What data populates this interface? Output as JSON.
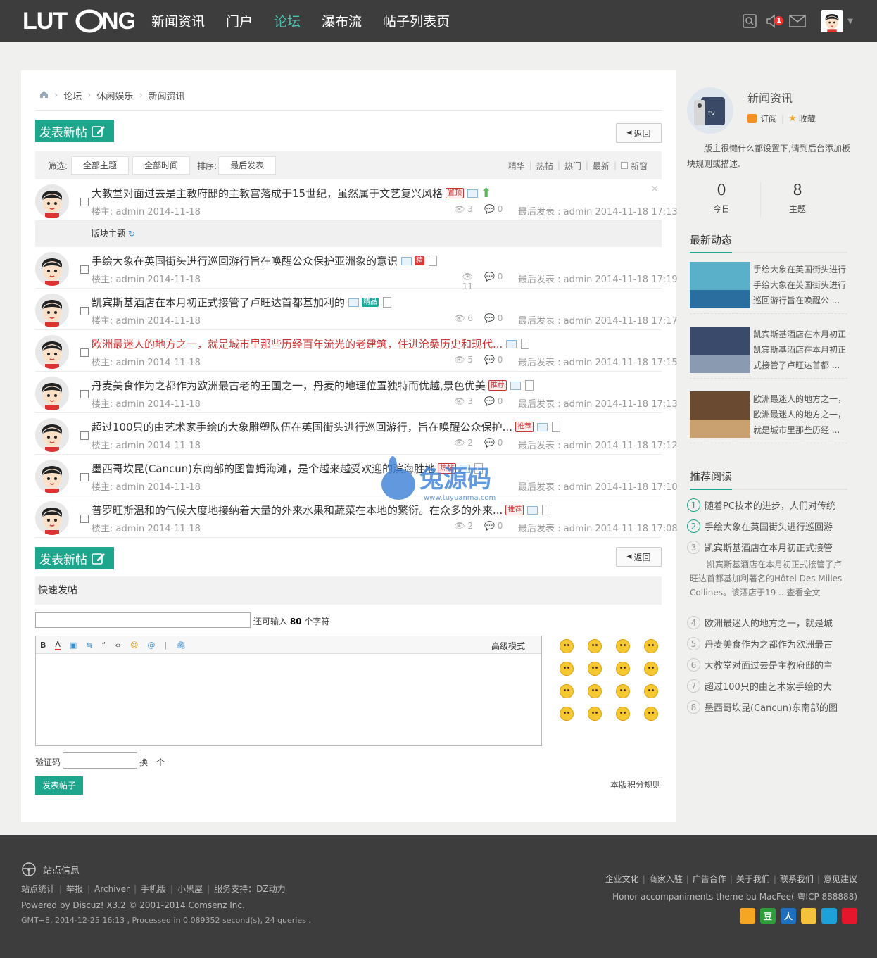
{
  "nav": {
    "logo": "LUTONG",
    "items": [
      {
        "label": "新闻资讯"
      },
      {
        "label": "门户"
      },
      {
        "label": "论坛"
      },
      {
        "label": "瀑布流"
      },
      {
        "label": "帖子列表页"
      }
    ],
    "active": 2,
    "msg_count": "1"
  },
  "breadcrumb": [
    "论坛",
    "休闲娱乐",
    "新闻资讯"
  ],
  "actions": {
    "new_post": "发表新帖",
    "back": "返回"
  },
  "filter": {
    "label": "筛选:",
    "all_topics": "全部主题",
    "all_time": "全部时间",
    "sort_label": "排序:",
    "last_post": "最后发表",
    "right": [
      "精华",
      "热帖",
      "热门",
      "最新"
    ],
    "new_window": "新窗"
  },
  "pinned": {
    "title": "大教堂对面过去是主教府邸的主教宫落成于15世纪，虽然属于文艺复兴风格",
    "tag": "置顶",
    "author": "楼主: admin 2014-11-18",
    "views": "3",
    "replies": "0",
    "last": "最后发表 : admin 2014-11-18 17:13"
  },
  "section_label": "版块主题",
  "threads": [
    {
      "title": "手绘大象在英国街头进行巡回游行旨在唤醒公众保护亚洲象的意识",
      "tag": "精",
      "author": "楼主: admin 2014-11-18",
      "views": "11",
      "replies": "0",
      "last": "最后发表 : admin 2014-11-18 17:19"
    },
    {
      "title": "凯宾斯基酒店在本月初正式接管了卢旺达首都基加利的",
      "tag": "精品",
      "author": "楼主: admin 2014-11-18",
      "views": "6",
      "replies": "0",
      "last": "最后发表 : admin 2014-11-18 17:17"
    },
    {
      "title": "欧洲最迷人的地方之一，就是城市里那些历经百年流光的老建筑，住进沧桑历史和现代...",
      "tag": "",
      "author": "楼主: admin 2014-11-18",
      "views": "5",
      "replies": "0",
      "last": "最后发表 : admin 2014-11-18 17:15"
    },
    {
      "title": "丹麦美食作为之都作为欧洲最古老的王国之一，丹麦的地理位置独特而优越,景色优美",
      "tag": "推荐",
      "author": "楼主: admin 2014-11-18",
      "views": "3",
      "replies": "0",
      "last": "最后发表 : admin 2014-11-18 17:13"
    },
    {
      "title": "超过100只的由艺术家手绘的大象雕塑队伍在英国街头进行巡回游行，旨在唤醒公众保护...",
      "tag": "推荐",
      "author": "楼主: admin 2014-11-18",
      "views": "2",
      "replies": "0",
      "last": "最后发表 : admin 2014-11-18 17:12"
    },
    {
      "title": "墨西哥坎昆(Cancun)东南部的图鲁姆海滩，是个越来越受欢迎的滨海胜地",
      "tag": "热帖",
      "author": "楼主: admin 2014-11-18",
      "views": "",
      "replies": "",
      "last": "最后发表 : admin 2014-11-18 17:10"
    },
    {
      "title": "普罗旺斯温和的气候大度地接纳着大量的外来水果和蔬菜在本地的繁衍。在众多的外来...",
      "tag": "推荐",
      "author": "楼主: admin 2014-11-18",
      "views": "2",
      "replies": "0",
      "last": "最后发表 : admin 2014-11-18 17:08"
    }
  ],
  "quick": {
    "title": "快速发帖",
    "hint_pre": "还可输入",
    "hint_num": "80",
    "hint_post": "个字符",
    "toolbar": [
      "B",
      "A",
      "▣",
      "⇆",
      "“",
      "‹›",
      "☺",
      "@",
      "|",
      "🖇"
    ],
    "advanced": "高级模式",
    "captcha": "验证码",
    "change": "换一个",
    "submit": "发表帖子",
    "rules": "本版积分规则"
  },
  "watermark": {
    "line1": "兔源码",
    "line2": "www.tuyuanma.com"
  },
  "forum": {
    "name": "新闻资讯",
    "subscribe": "订阅",
    "favorite": "收藏",
    "desc": "版主很懒什么都设置下,请到后台添加板块规则或描述.",
    "today": "0",
    "today_label": "今日",
    "topics": "8",
    "topics_label": "主题"
  },
  "dynamic": {
    "title": "最新动态",
    "items": [
      {
        "title": "手绘大象在英国街头进行",
        "text": "手绘大象在英国街头进行巡回游行旨在唤醒公 ..."
      },
      {
        "title": "凯宾斯基酒店在本月初正",
        "text": "凯宾斯基酒店在本月初正式接管了卢旺达首都 ..."
      },
      {
        "title": "欧洲最迷人的地方之一，",
        "text": "欧洲最迷人的地方之一，就是城市里那些历经 ..."
      }
    ]
  },
  "recommend": {
    "title": "推荐阅读",
    "items": [
      {
        "num": "1",
        "text": "随着PC技术的进步，人们对传统"
      },
      {
        "num": "2",
        "text": "手绘大象在英国街头进行巡回游"
      },
      {
        "num": "3",
        "text": "凯宾斯基酒店在本月初正式接管"
      },
      {
        "num": "4",
        "text": "欧洲最迷人的地方之一，就是城"
      },
      {
        "num": "5",
        "text": "丹麦美食作为之都作为欧洲最古"
      },
      {
        "num": "6",
        "text": "大教堂对面过去是主教府邸的主"
      },
      {
        "num": "7",
        "text": "超过100只的由艺术家手绘的大"
      },
      {
        "num": "8",
        "text": "墨西哥坎昆(Cancun)东南部的图"
      }
    ],
    "excerpt": "凯宾斯基酒店在本月初正式接管了卢旺达首都基加利著名的Hôtel Des Milles Collines。该酒店于19 ...查看全文"
  },
  "footer": {
    "site_info": "站点信息",
    "links": [
      "站点统计",
      "举报",
      "Archiver",
      "手机版",
      "小黑屋",
      "服务支持：DZ动力"
    ],
    "powered": "Powered by Discuz! X3.2 © 2001-2014 Comsenz Inc.",
    "gmt": "GMT+8, 2014-12-25 16:13 , Processed in 0.089352 second(s), 24 queries .",
    "right_links": [
      "企业文化",
      "商家入驻",
      "广告合作",
      "关于我们",
      "联系我们",
      "意见建议"
    ],
    "theme": "Honor accompaniments theme bu MacFee( 粤ICP 888888)",
    "social": [
      {
        "name": "rss",
        "glyph": "",
        "color": "#f5a623"
      },
      {
        "name": "douban",
        "glyph": "豆",
        "color": "#2e9e3a"
      },
      {
        "name": "renren",
        "glyph": "人",
        "color": "#1d6fbf"
      },
      {
        "name": "qzone",
        "glyph": "",
        "color": "#f5c33b"
      },
      {
        "name": "pengyou",
        "glyph": "",
        "color": "#1ca1d8"
      },
      {
        "name": "weibo",
        "glyph": "",
        "color": "#e6162d"
      }
    ]
  }
}
